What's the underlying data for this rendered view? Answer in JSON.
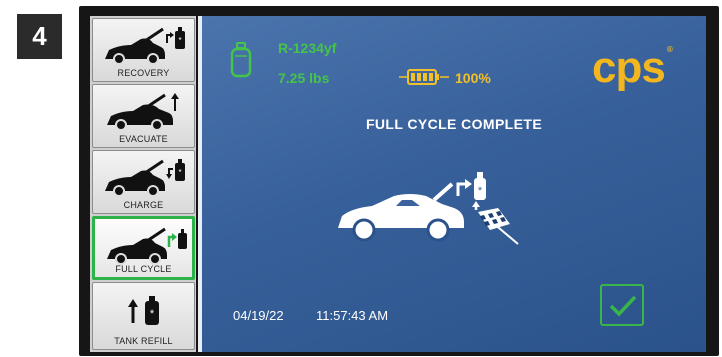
{
  "step": {
    "number": "4"
  },
  "sidebar": {
    "items": [
      {
        "label": "RECOVERY",
        "active": false
      },
      {
        "label": "EVACUATE",
        "active": false
      },
      {
        "label": "CHARGE",
        "active": false
      },
      {
        "label": "FULL CYCLE",
        "active": true
      },
      {
        "label": "TANK REFILL",
        "active": false
      }
    ]
  },
  "status_bar": {
    "refrigerant": "R-1234yf",
    "tank_weight": "7.25 lbs",
    "battery_percent": "100%"
  },
  "brand": {
    "logo": "cps",
    "mark": "®"
  },
  "main": {
    "status": "FULL CYCLE COMPLETE",
    "date": "04/19/22",
    "time": "11:57:43 AM"
  },
  "icons": {
    "tank": "refrigerant-tank-icon",
    "battery": "battery-icon",
    "hero": "car-finish-flag-icon",
    "confirm": "checkmark-icon"
  },
  "colors": {
    "accent_green": "#44c44a",
    "accent_yellow": "#f2c12a",
    "logo": "#f3b61f",
    "screen_blue": "#3b649e",
    "active_border": "#2db34a"
  }
}
